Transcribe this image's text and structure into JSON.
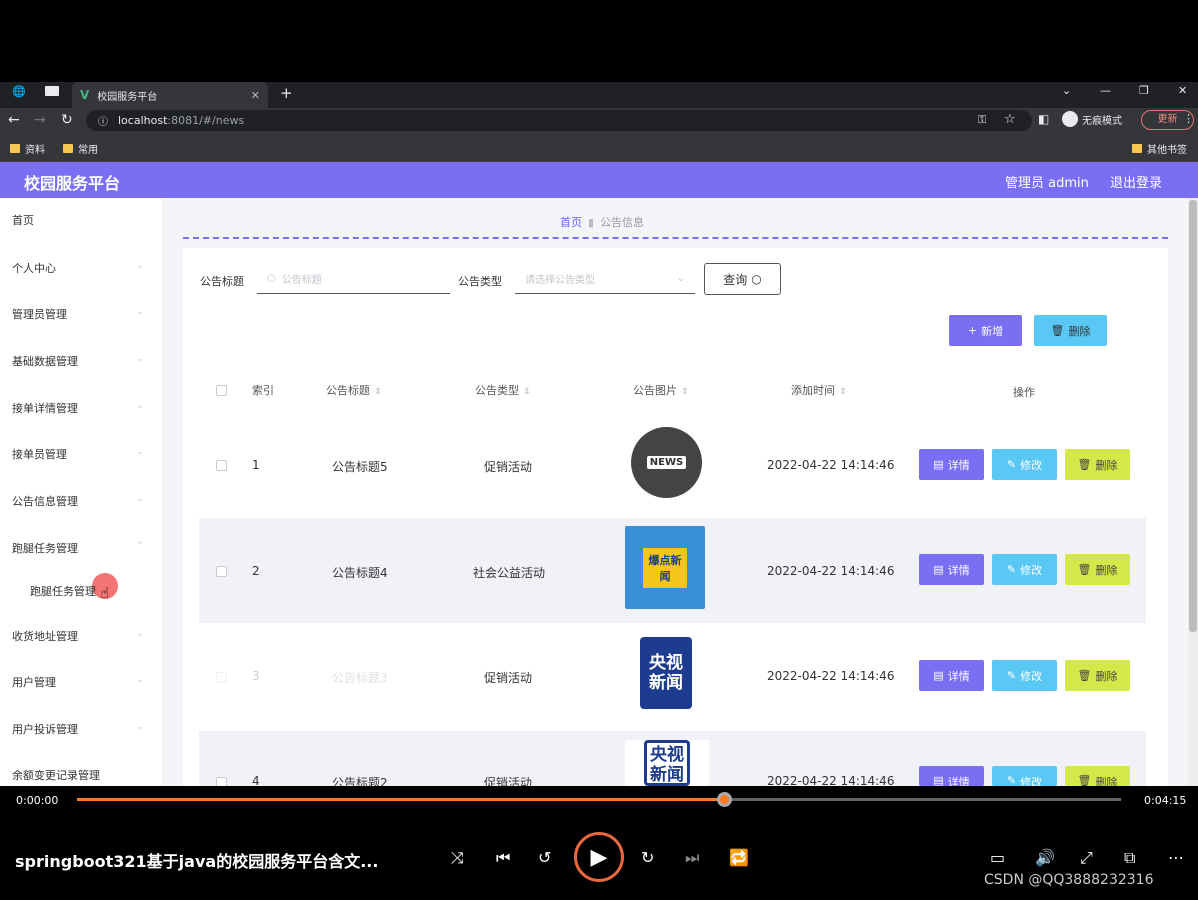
{
  "browser": {
    "tab_title": "校园服务平台",
    "url_host": "localhost",
    "url_path": ":8081/#/news",
    "incognito_label": "无痕模式",
    "update_label": "更新",
    "bookmarks": [
      "资料",
      "常用"
    ],
    "other_bookmarks": "其他书签"
  },
  "app": {
    "title": "校园服务平台",
    "user_label": "管理员 admin",
    "logout_label": "退出登录"
  },
  "sidebar": {
    "items": [
      {
        "label": "首页"
      },
      {
        "label": "个人中心"
      },
      {
        "label": "管理员管理"
      },
      {
        "label": "基础数据管理"
      },
      {
        "label": "接单详情管理"
      },
      {
        "label": "接单员管理"
      },
      {
        "label": "公告信息管理"
      },
      {
        "label": "跑腿任务管理"
      },
      {
        "label": "跑腿任务管理"
      },
      {
        "label": "收货地址管理"
      },
      {
        "label": "用户管理"
      },
      {
        "label": "用户投诉管理"
      },
      {
        "label": "余额变更记录管理"
      }
    ]
  },
  "breadcrumb": {
    "home": "首页",
    "current": "公告信息"
  },
  "search": {
    "title_label": "公告标题",
    "title_placeholder": "公告标题",
    "type_label": "公告类型",
    "type_placeholder": "请选择公告类型",
    "query_button": "查询"
  },
  "toolbar": {
    "add_label": "新增",
    "delete_label": "删除"
  },
  "table": {
    "headers": [
      "索引",
      "公告标题",
      "公告类型",
      "公告图片",
      "添加时间",
      "操作"
    ],
    "rows": [
      {
        "index": "1",
        "title": "公告标题5",
        "type": "促销活动",
        "image": "NEWS",
        "time": "2022-04-22 14:14:46"
      },
      {
        "index": "2",
        "title": "公告标题4",
        "type": "社会公益活动",
        "image": "爆点新闻",
        "time": "2022-04-22 14:14:46"
      },
      {
        "index": "3",
        "title": "公告标题3",
        "type": "促销活动",
        "image": "央视新闻",
        "time": "2022-04-22 14:14:46"
      },
      {
        "index": "4",
        "title": "公告标题2",
        "type": "促销活动",
        "image": "央视新闻",
        "time": "2022-04-22 14:14:46"
      }
    ],
    "row_actions": {
      "detail": "详情",
      "edit": "修改",
      "delete": "删除"
    }
  },
  "player": {
    "current_time": "0:00:00",
    "total_time": "0:04:15",
    "progress": 0.62,
    "video_title": "springboot321基于java的校园服务平台含文...",
    "watermark": "CSDN @QQ3888232316"
  },
  "colors": {
    "accent": "#7a6ff2",
    "edit": "#5ac8f5",
    "delete": "#d4e84a",
    "progress": "#ff7a1f"
  }
}
